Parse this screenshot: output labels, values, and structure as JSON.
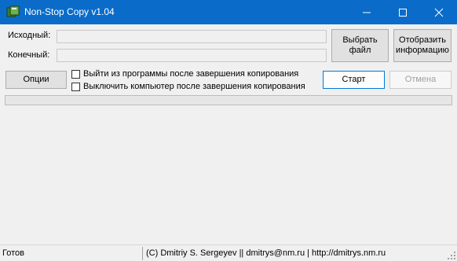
{
  "window": {
    "title": "Non-Stop Copy v1.04",
    "controls": {
      "minimize": "minimize-icon",
      "maximize": "maximize-icon",
      "close": "close-icon"
    }
  },
  "form": {
    "source_label": "Исходный:",
    "source_value": "",
    "dest_label": "Конечный:",
    "dest_value": ""
  },
  "buttons": {
    "choose_file": "Выбрать файл",
    "show_info": "Отобразить информацию",
    "options": "Опции",
    "start": "Старт",
    "cancel": "Отмена"
  },
  "checkboxes": [
    {
      "label": "Выйти из программы после завершения копирования",
      "checked": false
    },
    {
      "label": "Выключить компьютер после завершения копирования",
      "checked": false
    }
  ],
  "progress": {
    "fraction": 0
  },
  "status": {
    "state": "Готов",
    "credits": "(C) Dmitriy S. Sergeyev || dmitrys@nm.ru | http://dmitrys.nm.ru"
  },
  "colors": {
    "titlebar": "#0a6cc8",
    "default_button_border": "#0078d7",
    "progress_fill": "#06b025"
  }
}
